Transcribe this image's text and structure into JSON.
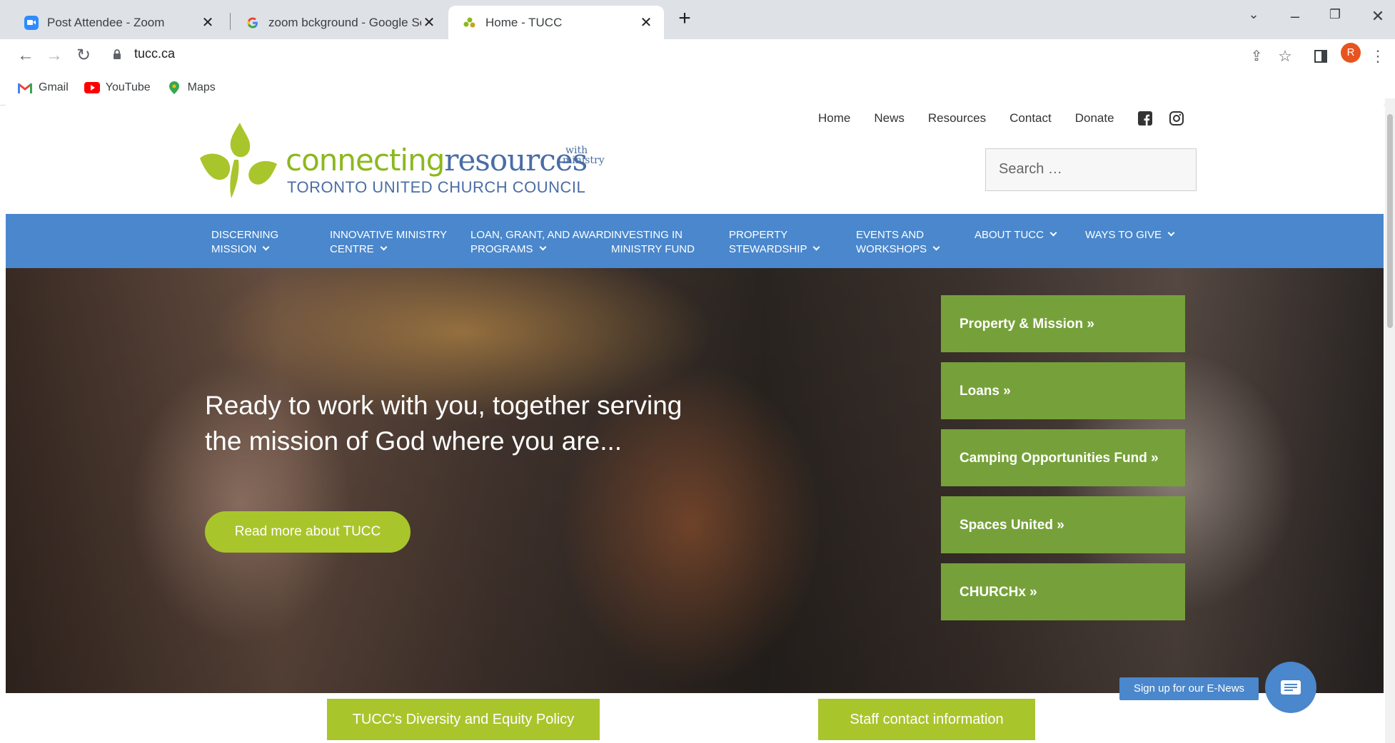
{
  "browser": {
    "tabs": [
      {
        "title": "Post Attendee - Zoom",
        "icon": "zoom-icon"
      },
      {
        "title": "zoom bckground - Google Search",
        "icon": "google-icon"
      },
      {
        "title": "Home - TUCC",
        "icon": "tucc-icon",
        "active": true
      }
    ],
    "url": "tucc.ca",
    "profile_initial": "R",
    "bookmarks": [
      {
        "label": "Gmail",
        "icon": "gmail-icon"
      },
      {
        "label": "YouTube",
        "icon": "youtube-icon"
      },
      {
        "label": "Maps",
        "icon": "maps-icon"
      }
    ]
  },
  "site": {
    "logo": {
      "word1": "connecting",
      "word2": "resources",
      "with": "with",
      "ministry": "ministry",
      "subtitle": "TORONTO UNITED CHURCH COUNCIL"
    },
    "top_nav": [
      "Home",
      "News",
      "Resources",
      "Contact",
      "Donate"
    ],
    "search_placeholder": "Search …",
    "main_nav": [
      {
        "line1": "DISCERNING",
        "line2": "MISSION",
        "dropdown": true
      },
      {
        "line1": "INNOVATIVE MINISTRY",
        "line2": "CENTRE",
        "dropdown": true
      },
      {
        "line1": "LOAN, GRANT, AND AWARD",
        "line2": "PROGRAMS",
        "dropdown": true
      },
      {
        "line1": "INVESTING IN",
        "line2": "MINISTRY FUND",
        "dropdown": false
      },
      {
        "line1": "PROPERTY",
        "line2": "STEWARDSHIP",
        "dropdown": true
      },
      {
        "line1": "EVENTS AND",
        "line2": "WORKSHOPS",
        "dropdown": true
      },
      {
        "line1": "ABOUT TUCC",
        "line2": "",
        "dropdown": true
      },
      {
        "line1": "WAYS TO GIVE",
        "line2": "",
        "dropdown": true
      }
    ],
    "hero": {
      "headline": "Ready to work with you, together serving the mission of God where you are...",
      "button": "Read more about TUCC"
    },
    "cards": [
      "Property & Mission »",
      "Loans »",
      "Camping Opportunities Fund »",
      "Spaces United »",
      "CHURCHx »"
    ],
    "bottom_buttons": [
      "TUCC's Diversity and Equity Policy",
      "Staff contact information"
    ],
    "enews_label": "Sign up for our E-News",
    "colors": {
      "nav_blue": "#4a87cc",
      "card_green": "#76a13a",
      "lime": "#a9c52c",
      "logo_green": "#8cb81e",
      "logo_blue": "#4a6da4"
    }
  }
}
